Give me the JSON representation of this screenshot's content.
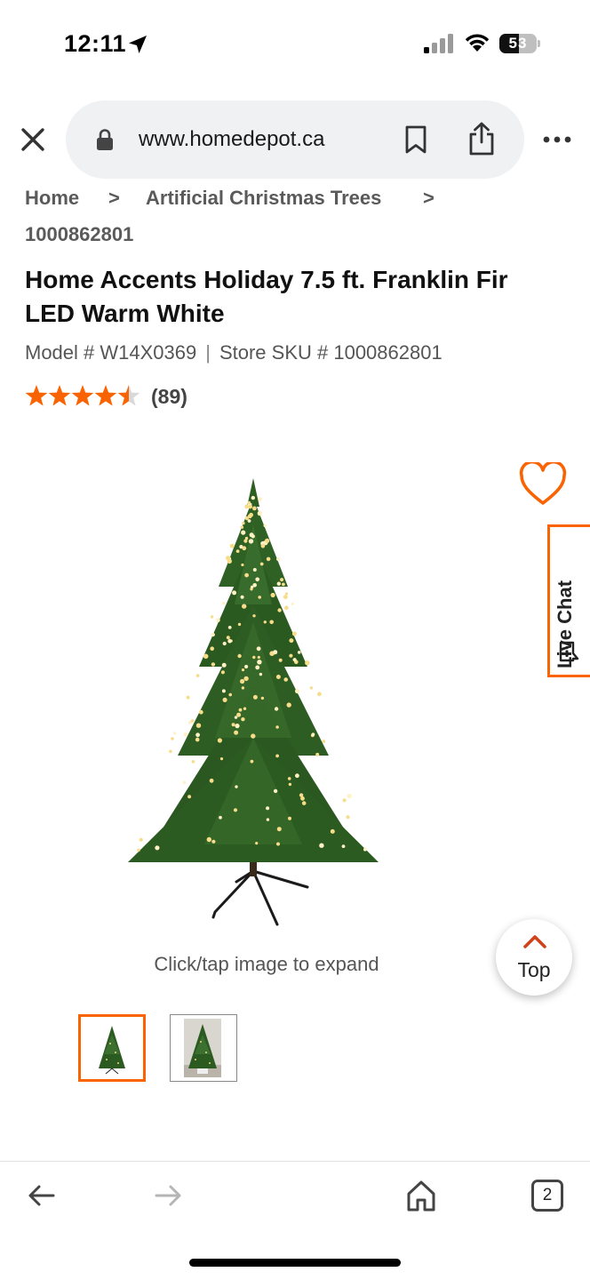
{
  "status_bar": {
    "time": "12:11",
    "battery_level": "53",
    "battery_fraction": 0.53,
    "icons": [
      "location-arrow-icon",
      "cellular-signal-icon",
      "wifi-icon",
      "battery-icon"
    ]
  },
  "browser": {
    "url": "www.homedepot.ca",
    "open_tabs": "2",
    "icons": [
      "close-icon",
      "lock-icon",
      "bookmark-icon",
      "share-icon",
      "more-icon",
      "back-arrow-icon",
      "forward-arrow-icon",
      "home-icon"
    ]
  },
  "breadcrumb": {
    "items": [
      "Home",
      "Artificial Christmas Trees",
      "1000862801"
    ],
    "separator": ">"
  },
  "product": {
    "brand": "Home Accents Holiday",
    "name": " 7.5 ft. Franklin Fir LED Warm White",
    "model_label": "Model # W14X0369",
    "divider": "|",
    "sku_label": "Store SKU # 1000862801",
    "rating": 4.5,
    "rating_max": 5,
    "review_count": "(89)"
  },
  "media": {
    "expand_hint": "Click/tap image to expand",
    "thumbnails": 2,
    "selected_thumbnail": 1
  },
  "live_chat": {
    "label": "Live Chat"
  },
  "top_button": {
    "label": "Top"
  },
  "colors": {
    "accent": "#f96302",
    "star": "#f96302",
    "text_primary": "#111111",
    "text_secondary": "#555555",
    "url_bar": "#f0f1f2"
  }
}
